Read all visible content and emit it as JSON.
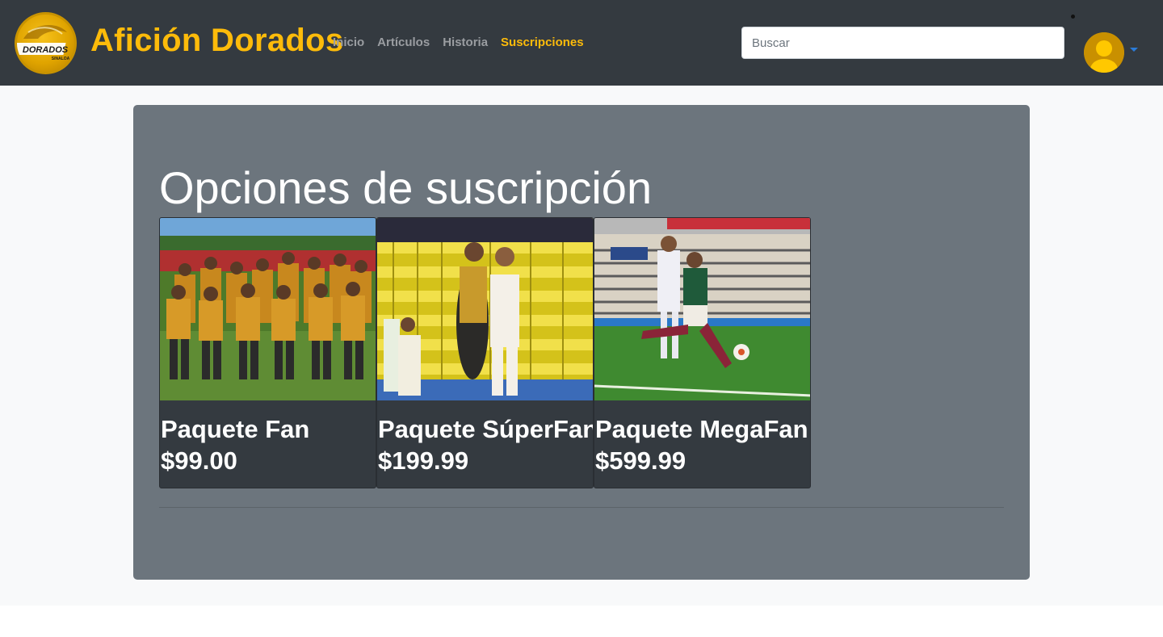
{
  "header": {
    "logo_text": "DORADOS",
    "logo_subtext": "SINALOA",
    "brand": "Afición Dorados",
    "nav": [
      {
        "label": "Inicio",
        "active": false
      },
      {
        "label": "Artículos",
        "active": false
      },
      {
        "label": "Historia",
        "active": false
      },
      {
        "label": "Suscripciones",
        "active": true
      }
    ],
    "search_placeholder": "Buscar",
    "avatar_icon": "user-avatar-icon",
    "brand_color": "#fdbb0a"
  },
  "main": {
    "title": "Opciones de suscripción",
    "cards": [
      {
        "name": "Paquete Fan",
        "price": "$99.00",
        "image": "team-photo-image"
      },
      {
        "name": "Paquete SúperFan",
        "price": "$199.99",
        "image": "match-action-image"
      },
      {
        "name": "Paquete MegaFan",
        "price": "$599.99",
        "image": "match-stadium-image"
      }
    ]
  },
  "colors": {
    "navbar": "#343a40",
    "panel": "#6c757d",
    "card": "#343a40",
    "accent": "#fdbb0a"
  }
}
